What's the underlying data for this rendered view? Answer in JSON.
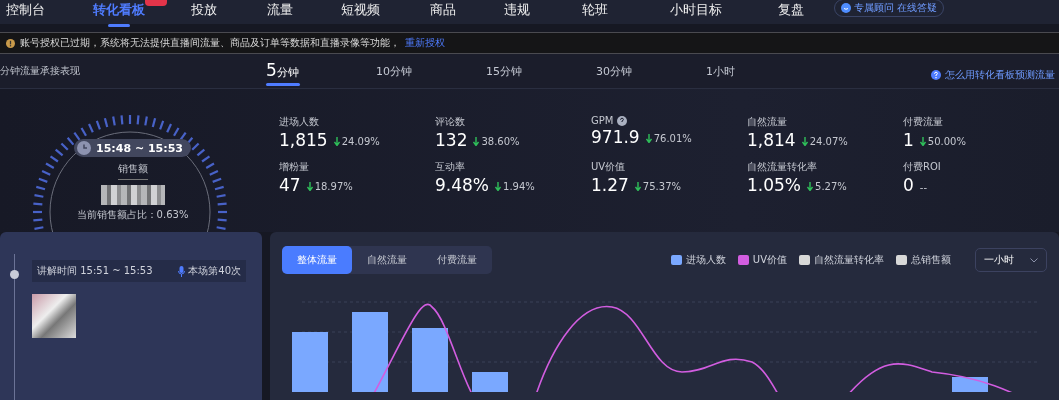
{
  "nav": {
    "items": [
      {
        "label": "控制台",
        "selected": false
      },
      {
        "label": "转化看板",
        "selected": true,
        "hot": true
      },
      {
        "label": "投放",
        "selected": false
      },
      {
        "label": "流量",
        "selected": false
      },
      {
        "label": "短视频",
        "selected": false
      },
      {
        "label": "商品",
        "selected": false
      },
      {
        "label": "违规",
        "selected": false
      },
      {
        "label": "轮班",
        "selected": false
      },
      {
        "label": "小时目标",
        "selected": false
      },
      {
        "label": "复盘",
        "selected": false
      }
    ],
    "consult": "专属顾问 在线答疑"
  },
  "notice": {
    "text": "账号授权已过期，系统将无法提供直播间流量、商品及订单等数据和直播录像等功能，",
    "link": "重新授权"
  },
  "section_title": "分钟流量承接表现",
  "time_tabs": [
    {
      "number": "5",
      "unit": "分钟",
      "selected": true
    },
    {
      "number": "10",
      "unit": "分钟",
      "selected": false
    },
    {
      "number": "15",
      "unit": "分钟",
      "selected": false
    },
    {
      "number": "30",
      "unit": "分钟",
      "selected": false
    },
    {
      "number": "1",
      "unit": "小时",
      "selected": false
    }
  ],
  "help_link": "怎么用转化看板预测流量",
  "gauge": {
    "time": "15:48 ~ 15:53",
    "label": "销售额",
    "share": "当前销售额占比：0.63%"
  },
  "metrics": [
    {
      "label": "进场人数",
      "value": "1,815",
      "change": "24.09%",
      "down": true
    },
    {
      "label": "评论数",
      "value": "132",
      "change": "38.60%",
      "down": true
    },
    {
      "label": "GPM",
      "value": "971.9",
      "change": "76.01%",
      "down": true,
      "help": true
    },
    {
      "label": "自然流量",
      "value": "1,814",
      "change": "24.07%",
      "down": true
    },
    {
      "label": "付费流量",
      "value": "1",
      "change": "50.00%",
      "down": true
    },
    {
      "label": "增粉量",
      "value": "47",
      "change": "18.97%",
      "down": true
    },
    {
      "label": "互动率",
      "value": "9.48%",
      "change": "1.94%",
      "down": true
    },
    {
      "label": "UV价值",
      "value": "1.27",
      "change": "75.37%",
      "down": true
    },
    {
      "label": "自然流量转化率",
      "value": "1.05%",
      "change": "5.27%",
      "down": true
    },
    {
      "label": "付费ROI",
      "value": "0",
      "change": "--"
    }
  ],
  "explain": {
    "time": "讲解时间 15:51 ~ 15:53",
    "count": "本场第40次"
  },
  "traffic_tabs": [
    {
      "label": "整体流量",
      "selected": true
    },
    {
      "label": "自然流量",
      "selected": false
    },
    {
      "label": "付费流量",
      "selected": false
    }
  ],
  "legend": [
    {
      "label": "进场人数",
      "color": "#7aa8ff"
    },
    {
      "label": "UV价值",
      "color": "#d25de0"
    },
    {
      "label": "自然流量转化率",
      "color": "#d8d8d8"
    },
    {
      "label": "总销售额",
      "color": "#d8d8d8"
    }
  ],
  "period_select": "一小时"
}
